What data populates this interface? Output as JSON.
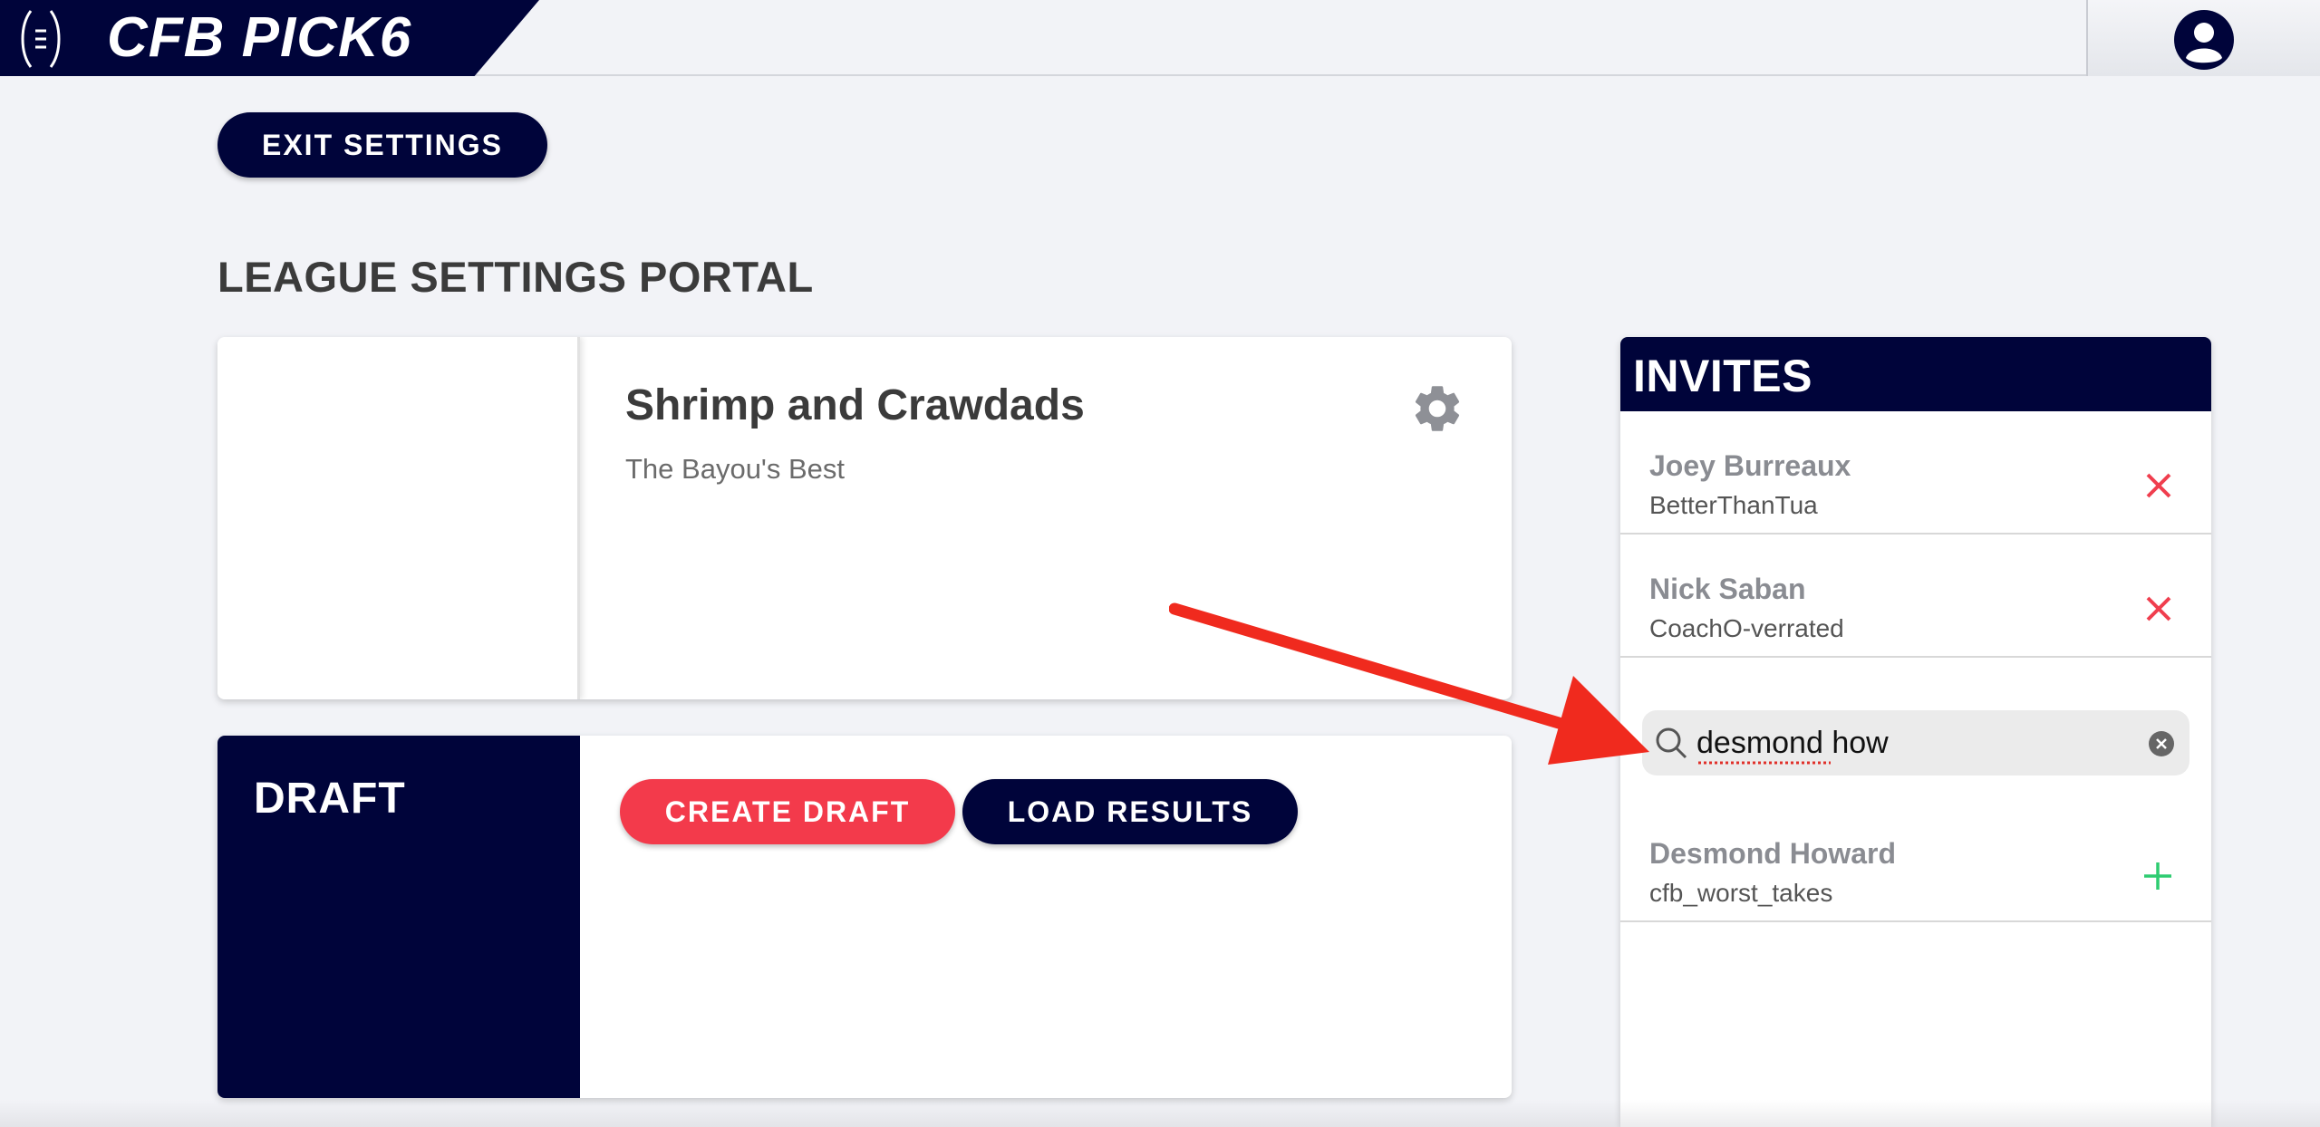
{
  "header": {
    "brand_title": "CFB PICK6",
    "logo_icon": "football-menu-icon",
    "profile_icon": "user-avatar-icon"
  },
  "actions": {
    "exit_settings_label": "EXIT SETTINGS"
  },
  "page_title": "LEAGUE SETTINGS PORTAL",
  "league": {
    "name": "Shrimp and Crawdads",
    "subtitle": "The Bayou's Best",
    "settings_icon": "gear-icon"
  },
  "draft": {
    "title": "DRAFT",
    "create_label": "CREATE DRAFT",
    "load_label": "LOAD RESULTS"
  },
  "invites": {
    "title": "INVITES",
    "pending": [
      {
        "name": "Joey Burreaux",
        "username": "BetterThanTua",
        "action_icon": "remove-x-icon"
      },
      {
        "name": "Nick Saban",
        "username": "CoachO-verrated",
        "action_icon": "remove-x-icon"
      }
    ],
    "search": {
      "value": "desmond how",
      "icon": "search-icon",
      "clear_icon": "clear-circle-icon"
    },
    "results": [
      {
        "name": "Desmond Howard",
        "username": "cfb_worst_takes",
        "action_icon": "add-plus-icon"
      }
    ]
  },
  "colors": {
    "navy": "#00043a",
    "accent_red": "#f33a4b",
    "remove_red": "#f03e4e",
    "add_green": "#2ecc71",
    "annotation_arrow": "#f02a1e",
    "page_bg": "#f2f3f7"
  }
}
